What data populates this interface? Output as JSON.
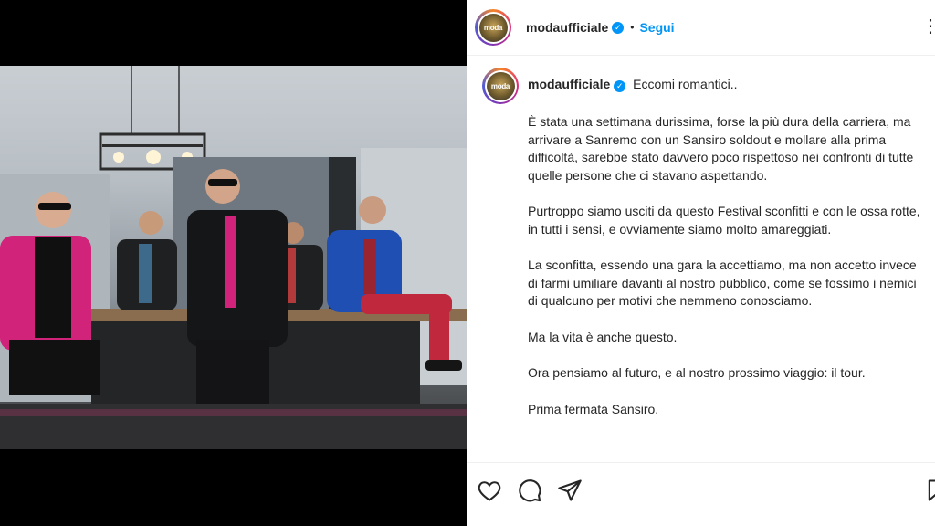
{
  "post": {
    "username": "modaufficiale",
    "follow_label": "Segui",
    "separator": "•",
    "more_label": "⋮",
    "avatar_logo": "moda",
    "caption_title": "Eccomi romantici..",
    "caption_paragraphs": [
      "È stata una settimana durissima, forse la più dura della carriera, ma arrivare a Sanremo con un Sansiro soldout e mollare alla prima difficoltà, sarebbe stato davvero poco rispettoso nei confronti di tutte quelle persone che ci stavano aspettando.",
      "Purtroppo siamo usciti da questo Festival sconfitti e con le ossa rotte, in tutti i sensi, e ovviamente siamo molto amareggiati.",
      "La sconfitta, essendo una gara la accettiamo, ma non accetto invece di farmi umiliare davanti al nostro pubblico, come se fossimo i nemici di qualcuno per motivi che nemmeno conosciamo.",
      "Ma la vita è anche questo.",
      "Ora pensiamo al futuro, e al nostro prossimo viaggio: il tour.",
      "Prima fermata Sansiro."
    ]
  },
  "icons": {
    "like": "heart-icon",
    "comment": "comment-icon",
    "share": "send-icon",
    "save": "bookmark-icon",
    "verified": "verified-badge-icon"
  },
  "colors": {
    "accent": "#0095f6",
    "text": "#262626",
    "pink_jacket": "#d1237a",
    "blue_jacket": "#1f4fb3"
  }
}
